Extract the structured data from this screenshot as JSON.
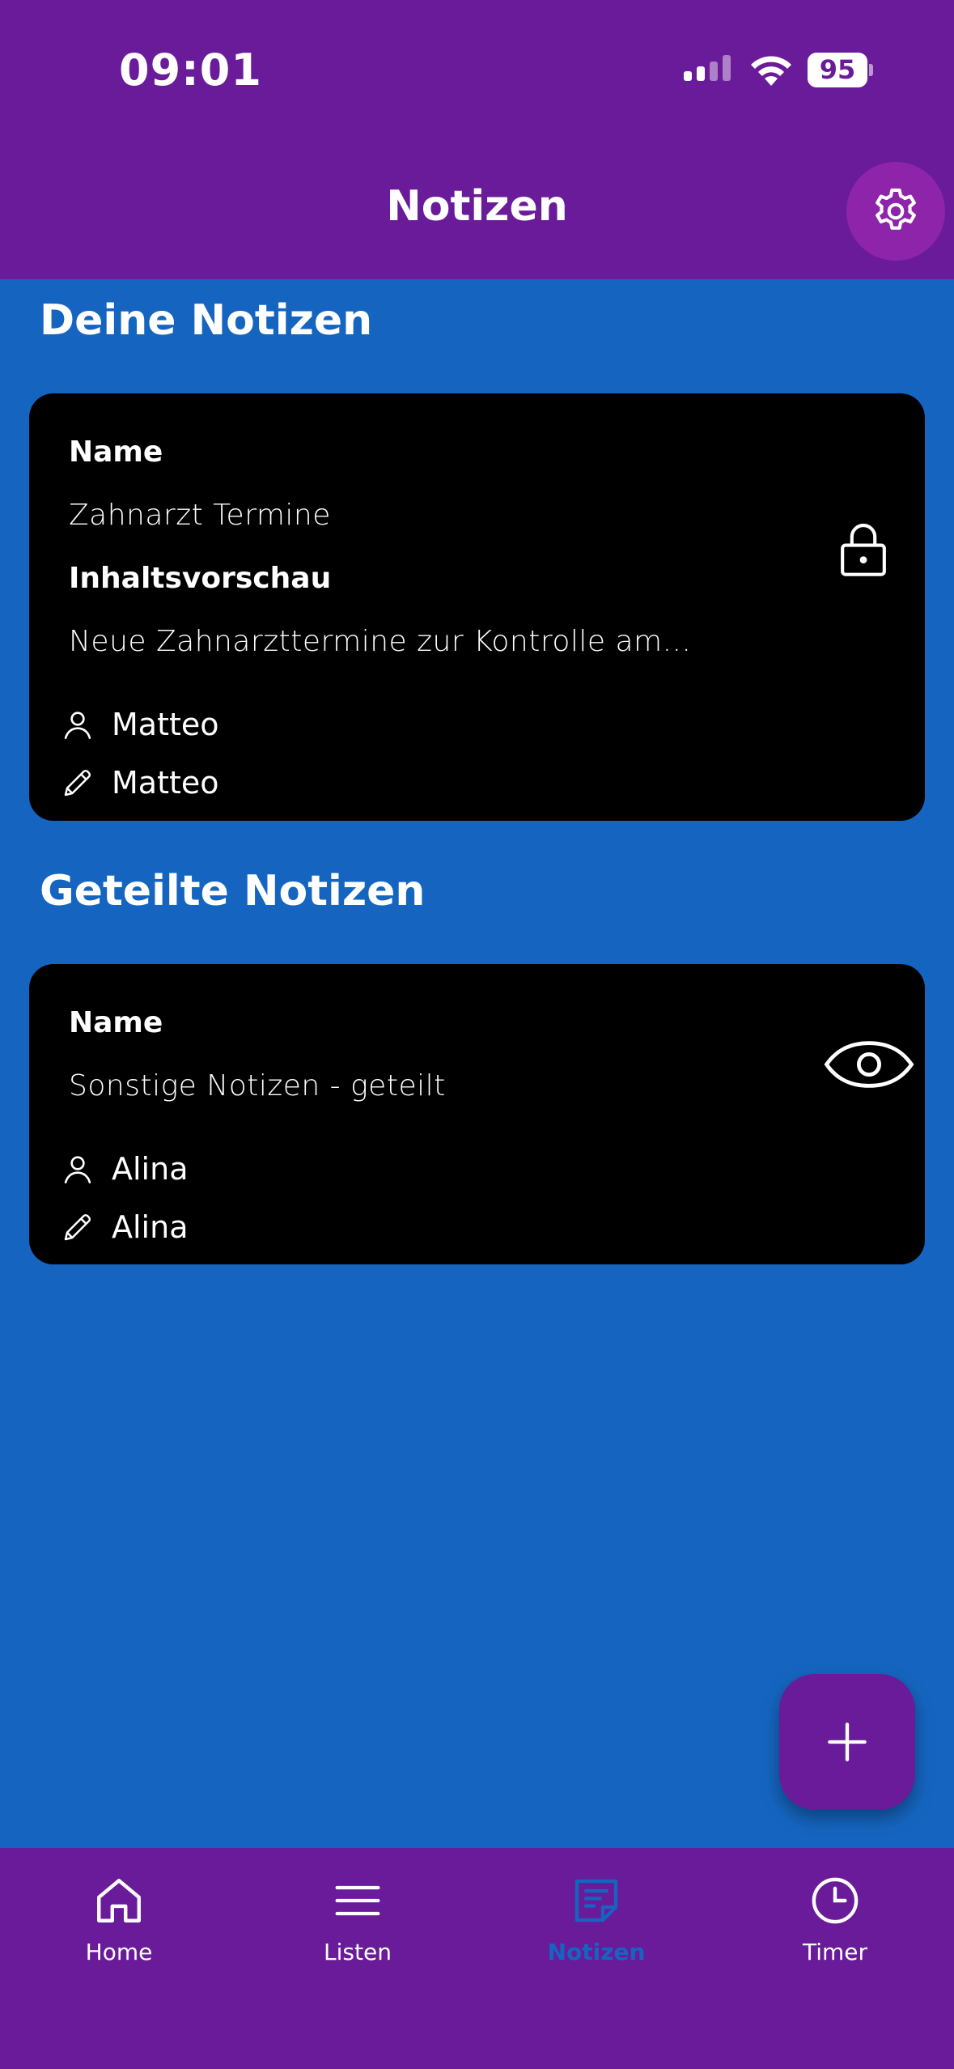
{
  "status_bar": {
    "time": "09:01",
    "battery": "95"
  },
  "app_bar": {
    "title": "Notizen",
    "settings_icon": "gear-icon"
  },
  "sections": {
    "own": {
      "title": "Deine Notizen",
      "note": {
        "name_label": "Name",
        "name": "Zahnarzt Termine",
        "preview_label": "Inhaltsvorschau",
        "preview": "Neue Zahnarzttermine zur Kontrolle am...",
        "owner": "Matteo",
        "editor": "Matteo",
        "status_icon": "lock-icon"
      }
    },
    "shared": {
      "title": "Geteilte Notizen",
      "note": {
        "name_label": "Name",
        "name": "Sonstige Notizen - geteilt",
        "owner": "Alina",
        "editor": "Alina",
        "status_icon": "eye-icon"
      }
    }
  },
  "fab": {
    "icon": "plus-icon"
  },
  "bottom_nav": {
    "items": [
      {
        "label": "Home",
        "icon": "home-icon"
      },
      {
        "label": "Listen",
        "icon": "menu-icon"
      },
      {
        "label": "Notizen",
        "icon": "note-icon",
        "active": true
      },
      {
        "label": "Timer",
        "icon": "clock-icon"
      }
    ]
  },
  "colors": {
    "primary": "#6a1b9a",
    "background": "#1565c0",
    "card": "#000000",
    "accent_active": "#1565c0"
  }
}
